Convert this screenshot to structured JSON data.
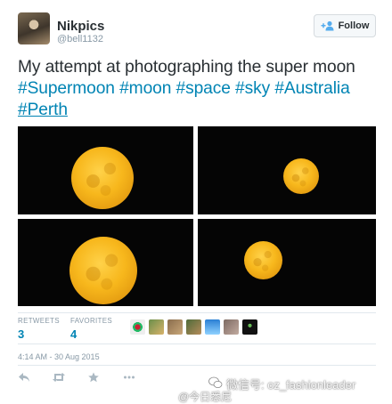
{
  "user": {
    "name": "Nikpics",
    "handle": "@bell1132"
  },
  "follow_button": {
    "label": "Follow"
  },
  "tweet": {
    "text_plain": "My attempt at photographing the super moon",
    "hashtags": [
      "#Supermoon",
      "#moon",
      "#space",
      "#sky",
      "#Australia",
      "#Perth"
    ]
  },
  "photos": [
    {
      "alt": "moon-photo-1"
    },
    {
      "alt": "moon-photo-2"
    },
    {
      "alt": "moon-photo-3"
    },
    {
      "alt": "moon-photo-4"
    }
  ],
  "stats": {
    "retweets_label": "RETWEETS",
    "retweets_value": "3",
    "favorites_label": "FAVORITES",
    "favorites_value": "4"
  },
  "timestamp": "4:14 AM - 30 Aug 2015",
  "actions": [
    "reply-icon",
    "retweet-icon",
    "favorite-icon",
    "more-icon"
  ],
  "watermark": {
    "line1": "微信号: oz_fashionleader",
    "line2": "@今日悉尼"
  },
  "colors": {
    "link": "#0084b4",
    "text": "#292f33",
    "muted": "#8899a6",
    "moon": "#f7b71c"
  }
}
